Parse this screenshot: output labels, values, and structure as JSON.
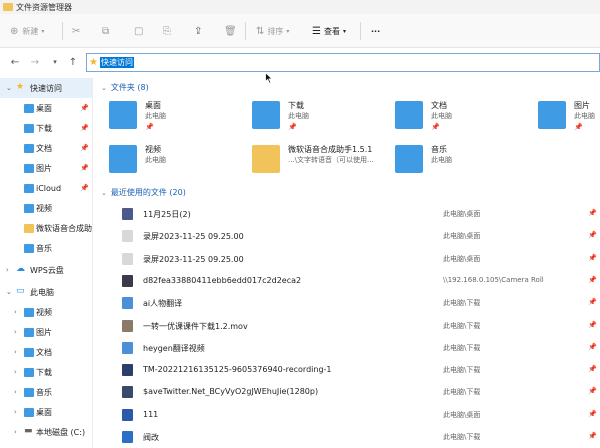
{
  "window": {
    "title": "文件资源管理器"
  },
  "toolbar": {
    "new_label": "新建",
    "sort_label": "排序",
    "view_label": "查看",
    "more_label": "···"
  },
  "address": {
    "current": "快速访问"
  },
  "sidebar": {
    "quick_access": "快速访问",
    "quick_items": [
      {
        "label": "桌面",
        "pinned": true
      },
      {
        "label": "下载",
        "pinned": true
      },
      {
        "label": "文档",
        "pinned": true
      },
      {
        "label": "图片",
        "pinned": true
      },
      {
        "label": "iCloud",
        "pinned": true
      },
      {
        "label": "视频",
        "pinned": false
      },
      {
        "label": "微软语音合成助",
        "pinned": false
      },
      {
        "label": "音乐",
        "pinned": false
      }
    ],
    "wps": "WPS云盘",
    "this_pc": "此电脑",
    "pc_items": [
      "视频",
      "图片",
      "文档",
      "下载",
      "音乐",
      "桌面",
      "本地磁盘 (C:)"
    ]
  },
  "folders_section": {
    "label": "文件夹 (8)"
  },
  "folders": [
    {
      "name": "桌面",
      "sub": "此电脑",
      "pinned": true,
      "color": "#3f9be4"
    },
    {
      "name": "下载",
      "sub": "此电脑",
      "pinned": true,
      "color": "#3f9be4"
    },
    {
      "name": "文档",
      "sub": "此电脑",
      "pinned": true,
      "color": "#3f9be4"
    },
    {
      "name": "图片",
      "sub": "此电脑",
      "pinned": true,
      "color": "#3f9be4"
    },
    {
      "name": "视频",
      "sub": "此电脑",
      "pinned": false,
      "color": "#3f9be4"
    },
    {
      "name": "微软语音合成助手1.5.1",
      "sub": "...\\文字转语音（可以使用...",
      "pinned": false,
      "color": "#f2c25b"
    },
    {
      "name": "音乐",
      "sub": "此电脑",
      "pinned": false,
      "color": "#3f9be4"
    }
  ],
  "recent_section": {
    "label": "最近使用的文件 (20)"
  },
  "recent": [
    {
      "name": "11月25日(2)",
      "loc": "此电脑\\桌面",
      "color": "#4a5a8a"
    },
    {
      "name": "录屏2023-11-25 09.25.00",
      "loc": "此电脑\\桌面",
      "color": "#d8d8d8"
    },
    {
      "name": "录屏2023-11-25 09.25.00",
      "loc": "此电脑\\桌面",
      "color": "#d8d8d8"
    },
    {
      "name": "d82fea33880411ebb6edd017c2d2eca2",
      "loc": "\\\\192.168.0.105\\Camera Roll",
      "color": "#3a3a4a"
    },
    {
      "name": "ai人物翻译",
      "loc": "此电脑\\下载",
      "color": "#4b8fd6"
    },
    {
      "name": "一转一优课课件下载1.2.mov",
      "loc": "此电脑\\下载",
      "color": "#8a7a6a"
    },
    {
      "name": "heygen翻译视频",
      "loc": "此电脑\\下载",
      "color": "#4b8fd6"
    },
    {
      "name": "TM-20221216135125-9605376940-recording-1",
      "loc": "此电脑\\下载",
      "color": "#2d3e6a"
    },
    {
      "name": "$aveTwitter.Net_BCyVyO2gJWEhuJie(1280p)",
      "loc": "此电脑\\下载",
      "color": "#3a4a6a"
    },
    {
      "name": "111",
      "loc": "此电脑\\桌面",
      "color": "#2a5aa8"
    },
    {
      "name": "阀改",
      "loc": "此电脑\\下载",
      "color": "#2b6fc4"
    }
  ],
  "pin_glyph": "📌"
}
